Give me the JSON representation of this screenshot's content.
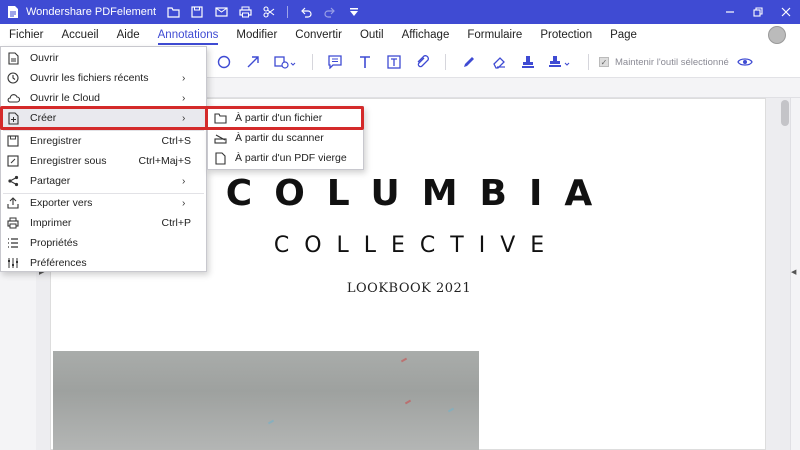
{
  "window": {
    "title": "Wondershare PDFelement",
    "accent": "#3f4bd3"
  },
  "menubar": {
    "items": [
      "Fichier",
      "Accueil",
      "Aide",
      "Annotations",
      "Modifier",
      "Convertir",
      "Outil",
      "Affichage",
      "Formulaire",
      "Protection",
      "Page"
    ],
    "active": "Annotations"
  },
  "toolbar": {
    "keep_tool_label": "Maintenir l'outil sélectionné"
  },
  "file_menu": {
    "items": [
      {
        "label": "Ouvrir",
        "icon": "open-file-icon"
      },
      {
        "label": "Ouvrir les fichiers récents",
        "icon": "clock-icon",
        "submenu": true
      },
      {
        "label": "Ouvrir le Cloud",
        "icon": "cloud-icon",
        "submenu": true
      },
      {
        "label": "Créer",
        "icon": "create-file-icon",
        "submenu": true,
        "highlighted": true
      },
      {
        "label": "Enregistrer",
        "icon": "save-icon",
        "shortcut": "Ctrl+S"
      },
      {
        "label": "Enregistrer sous",
        "icon": "save-as-icon",
        "shortcut": "Ctrl+Maj+S"
      },
      {
        "label": "Partager",
        "icon": "share-icon",
        "submenu": true
      },
      {
        "label": "Exporter vers",
        "icon": "export-icon",
        "submenu": true
      },
      {
        "label": "Imprimer",
        "icon": "print-icon",
        "shortcut": "Ctrl+P"
      },
      {
        "label": "Propriétés",
        "icon": "properties-icon"
      },
      {
        "label": "Préférences",
        "icon": "preferences-icon"
      }
    ]
  },
  "create_submenu": {
    "items": [
      {
        "label": "À partir d'un fichier",
        "icon": "folder-icon",
        "highlighted": true
      },
      {
        "label": "À partir du scanner",
        "icon": "scanner-icon"
      },
      {
        "label": "À partir d'un PDF vierge",
        "icon": "blank-page-icon"
      }
    ]
  },
  "document": {
    "title": "COLUMBIA",
    "subtitle": "COLLECTIVE",
    "tagline": "LOOKBOOK 2021"
  },
  "highlight_color": "#d42a2a"
}
